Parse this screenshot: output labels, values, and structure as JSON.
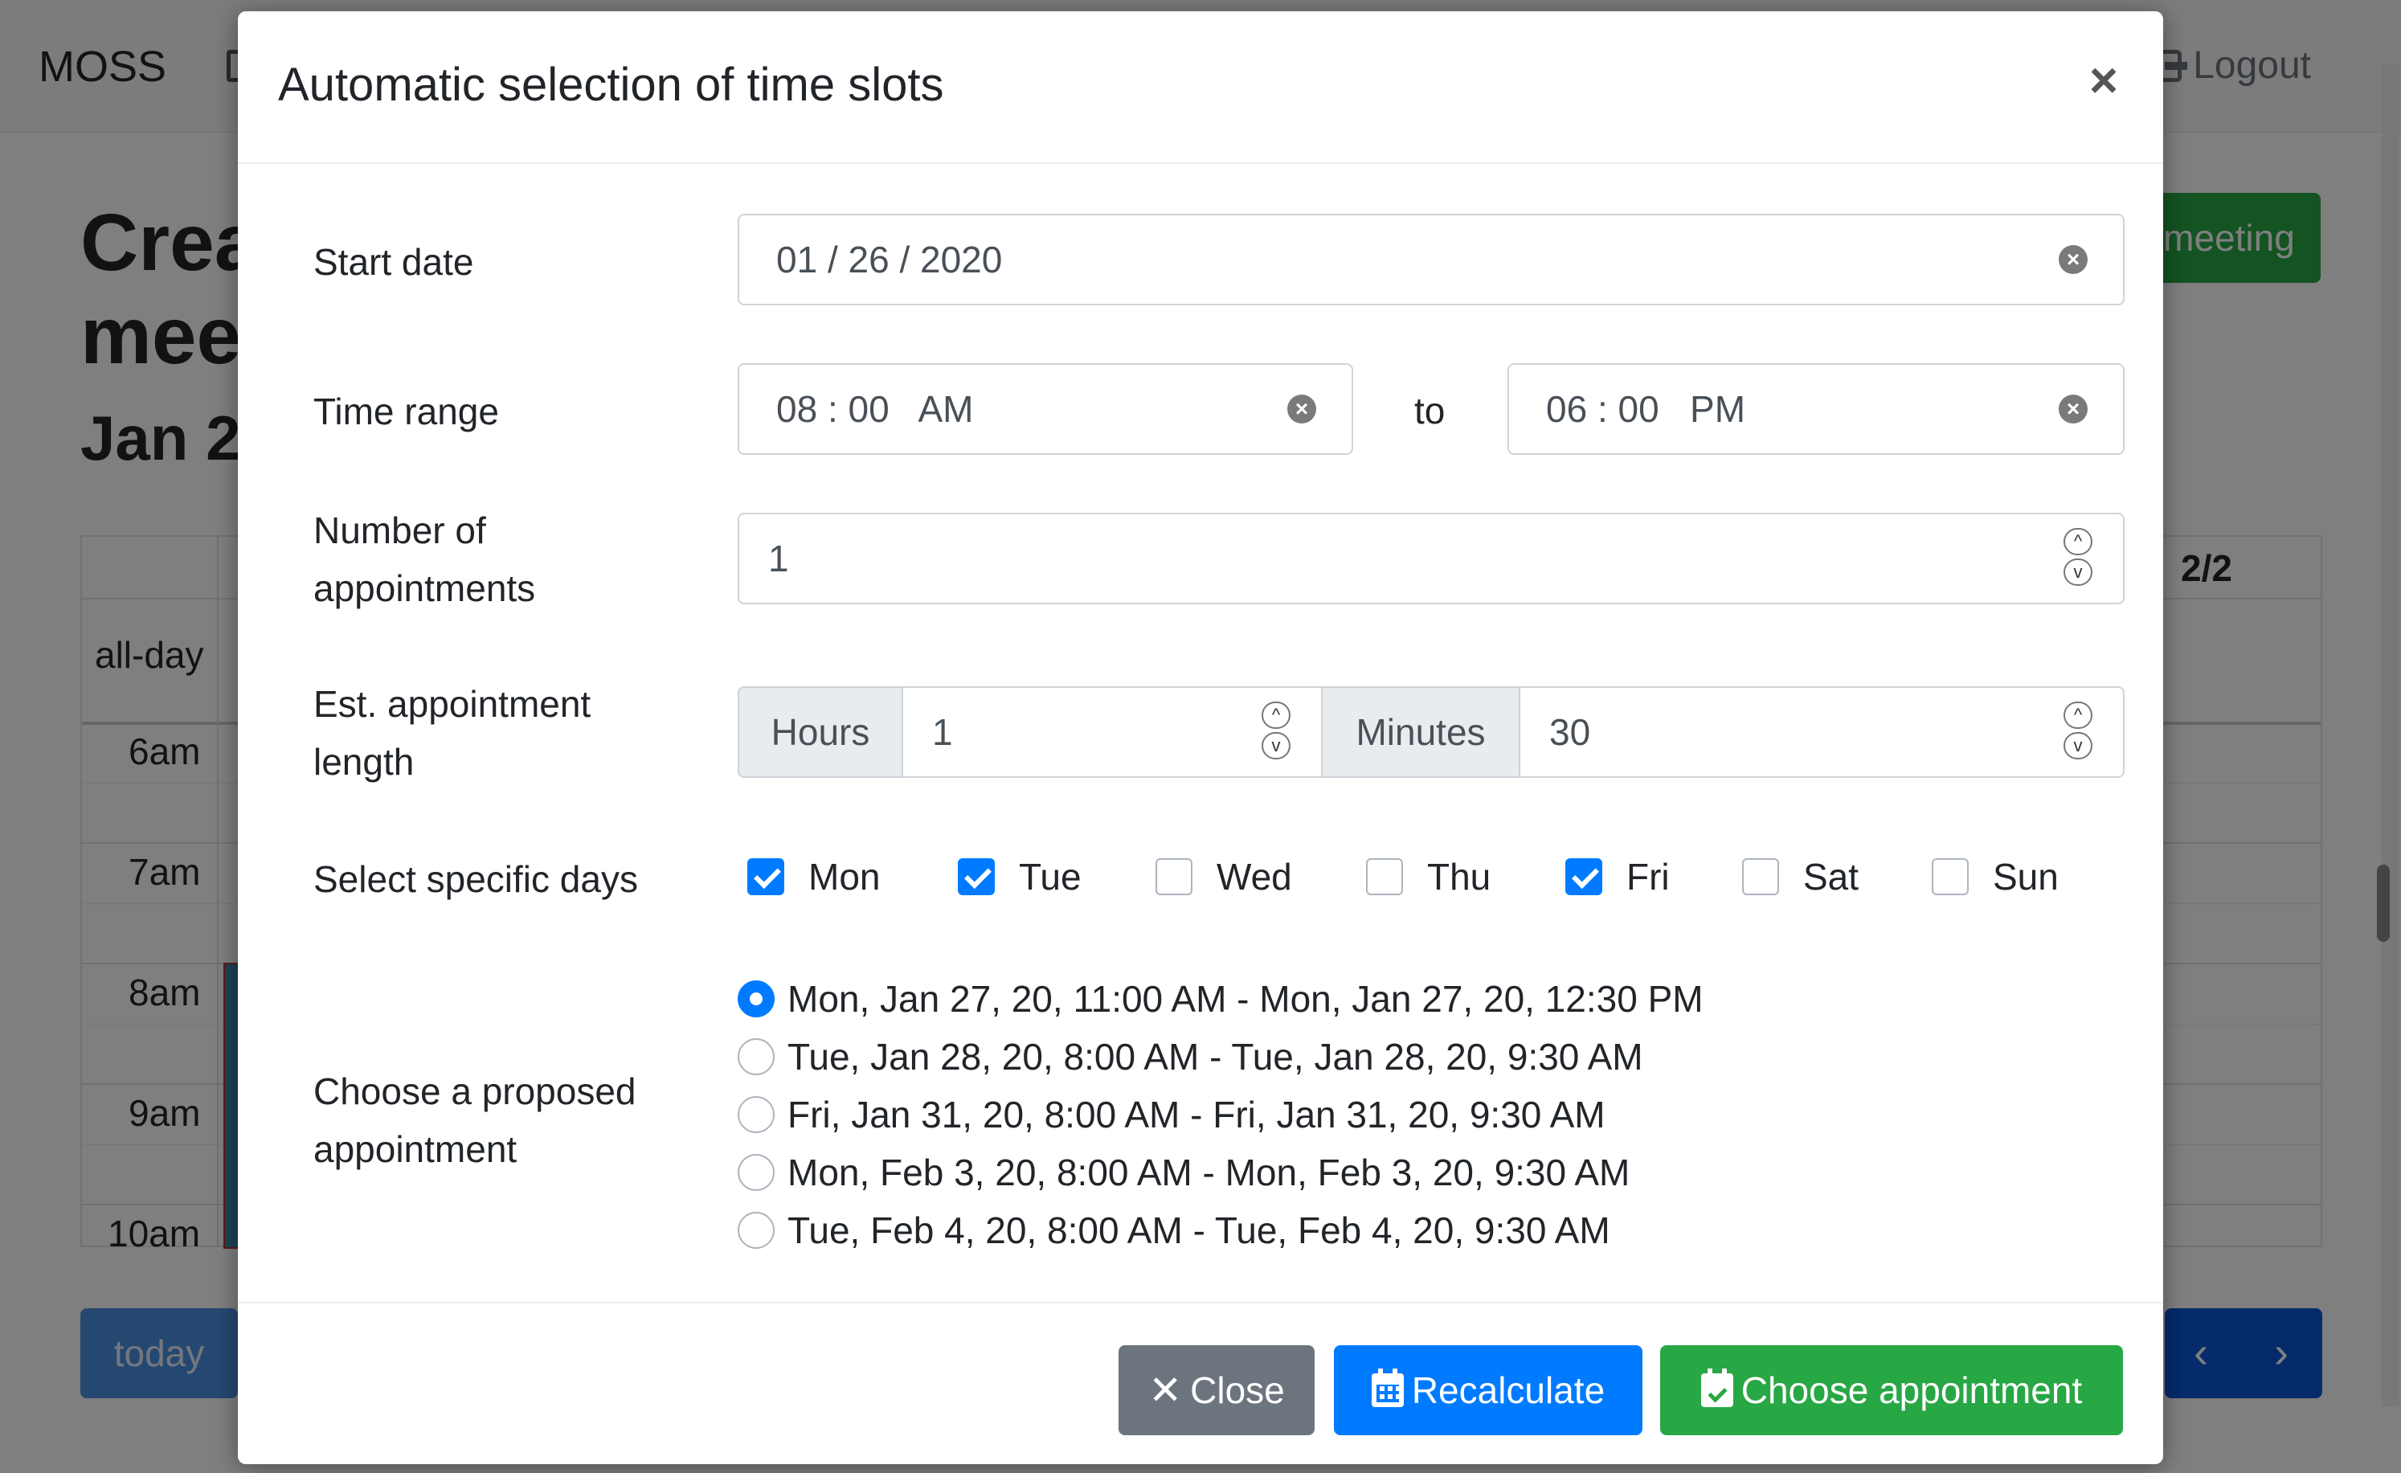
{
  "background": {
    "brand": "MOSS",
    "logout_label": "Logout",
    "page_title": "Crea\nmeet",
    "page_date": "Jan 2",
    "meeting_button_label": "meeting",
    "calendar": {
      "allday_label": "all-day",
      "header_right": "2/2",
      "hours": [
        "6am",
        "7am",
        "8am",
        "9am",
        "10am"
      ]
    },
    "today_label": "today",
    "prev_icon": "‹",
    "next_icon": "›"
  },
  "modal": {
    "title": "Automatic selection of time slots",
    "close_icon": "×",
    "start_date": {
      "label": "Start date",
      "value": "01 / 26 / 2020"
    },
    "time_range": {
      "label": "Time range",
      "from": "08 : 00   AM",
      "separator": "to",
      "to": "06 : 00   PM"
    },
    "num_appointments": {
      "label": "Number of appointments",
      "value": "1"
    },
    "appointment_length": {
      "label": "Est. appointment length",
      "hours_addon": "Hours",
      "hours_value": "1",
      "minutes_addon": "Minutes",
      "minutes_value": "30"
    },
    "days": {
      "label": "Select specific days",
      "items": [
        {
          "label": "Mon",
          "checked": true
        },
        {
          "label": "Tue",
          "checked": true
        },
        {
          "label": "Wed",
          "checked": false
        },
        {
          "label": "Thu",
          "checked": false
        },
        {
          "label": "Fri",
          "checked": true
        },
        {
          "label": "Sat",
          "checked": false
        },
        {
          "label": "Sun",
          "checked": false
        }
      ]
    },
    "proposed": {
      "label": "Choose a proposed appointment",
      "options": [
        {
          "label": "Mon, Jan 27, 20, 11:00 AM - Mon, Jan 27, 20, 12:30 PM",
          "selected": true
        },
        {
          "label": "Tue, Jan 28, 20, 8:00 AM - Tue, Jan 28, 20, 9:30 AM",
          "selected": false
        },
        {
          "label": "Fri, Jan 31, 20, 8:00 AM - Fri, Jan 31, 20, 9:30 AM",
          "selected": false
        },
        {
          "label": "Mon, Feb 3, 20, 8:00 AM - Mon, Feb 3, 20, 9:30 AM",
          "selected": false
        },
        {
          "label": "Tue, Feb 4, 20, 8:00 AM - Tue, Feb 4, 20, 9:30 AM",
          "selected": false
        }
      ]
    },
    "footer": {
      "close_label": "Close",
      "recalculate_label": "Recalculate",
      "choose_label": "Choose appointment"
    },
    "colors": {
      "primary": "#007bff",
      "success": "#28a745",
      "secondary": "#6c757d"
    }
  }
}
